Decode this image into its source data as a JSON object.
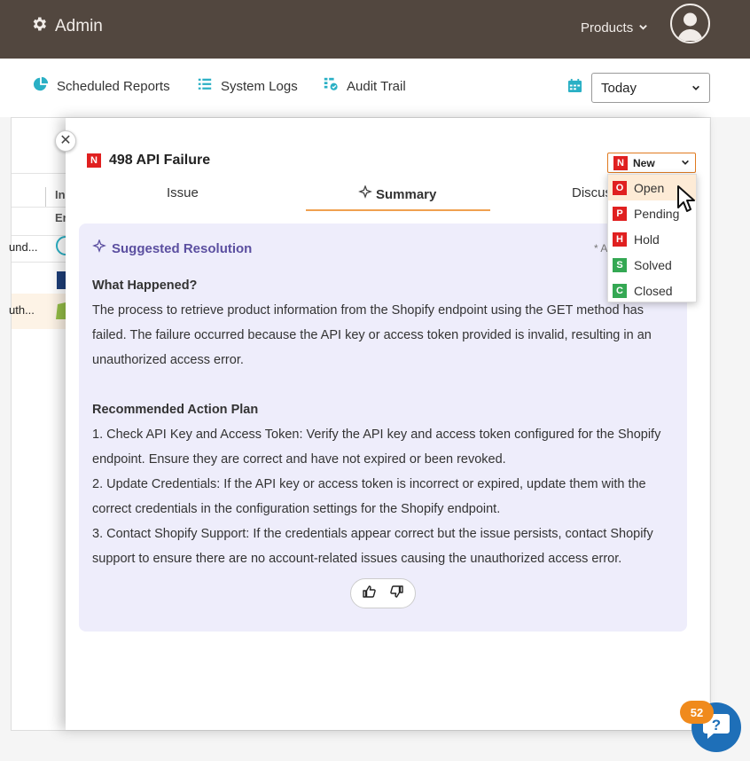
{
  "topbar": {
    "brand": "Admin",
    "products_label": "Products"
  },
  "toolbar": {
    "scheduled_reports": "Scheduled Reports",
    "system_logs": "System Logs",
    "audit_trail": "Audit Trail",
    "date_filter": "Today"
  },
  "background_table": {
    "col_header_1": "In",
    "col_header_2": "Er",
    "row1_text": "und...",
    "row3_text": "uth..."
  },
  "ticket": {
    "badge_letter": "N",
    "title": "498 API Failure",
    "status": "New",
    "status_options": [
      {
        "letter": "O",
        "label": "Open",
        "color": "#e02020"
      },
      {
        "letter": "P",
        "label": "Pending",
        "color": "#e02020"
      },
      {
        "letter": "H",
        "label": "Hold",
        "color": "#e02020"
      },
      {
        "letter": "S",
        "label": "Solved",
        "color": "#34a853"
      },
      {
        "letter": "C",
        "label": "Closed",
        "color": "#34a853"
      }
    ]
  },
  "tabs": {
    "issue": "Issue",
    "summary": "Summary",
    "discussion": "Discus"
  },
  "resolution": {
    "title": "Suggested Resolution",
    "note": "* A",
    "what_happened_heading": "What Happened?",
    "what_happened_text": "The process to retrieve product information from the Shopify endpoint using the GET method has failed. The failure occurred because the API key or access token provided is invalid, resulting in an unauthorized access error.",
    "action_plan_heading": "Recommended Action Plan",
    "step1": "1. Check API Key and Access Token: Verify the API key and access token configured for the Shopify endpoint. Ensure they are correct and have not expired or been revoked.",
    "step2": "2. Update Credentials: If the API key or access token is incorrect or expired, update them with the correct credentials in the configuration settings for the Shopify endpoint.",
    "step3": "3. Contact Shopify Support: If the credentials appear correct but the issue persists, contact Shopify support to ensure there are no account-related issues causing the unauthorized access error."
  },
  "help": {
    "badge_count": "52"
  },
  "colors": {
    "topbar_bg": "#52473f",
    "accent_orange": "#f0a050",
    "card_bg": "#eeedfb",
    "resolution_title": "#5b4fa0",
    "help_blue": "#1e6fb8"
  }
}
